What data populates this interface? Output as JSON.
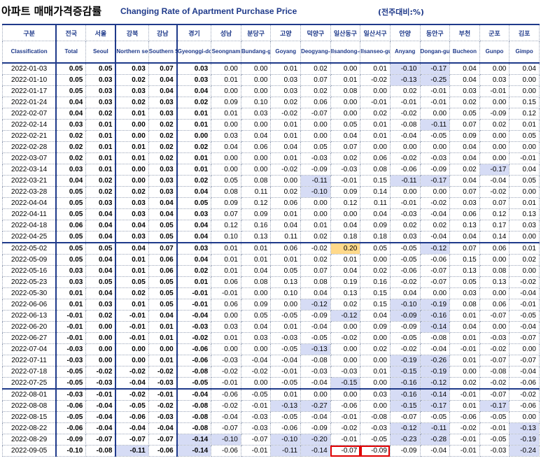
{
  "title_kr": "아파트 매매가격증감률",
  "title_en": "Changing Rate of Apartment Purchase Price",
  "title_note": "(전주대비:%)",
  "columns": [
    {
      "kr": "구분",
      "en": "Classification"
    },
    {
      "kr": "전국",
      "en": "Total"
    },
    {
      "kr": "서울",
      "en": "Seoul"
    },
    {
      "kr": "강북",
      "en": "Northern seoul"
    },
    {
      "kr": "강남",
      "en": "Southern Seoul"
    },
    {
      "kr": "경기",
      "en": "Gyeonggi-do"
    },
    {
      "kr": "성남",
      "en": "Seongnam"
    },
    {
      "kr": "분당구",
      "en": "Bundang-gu"
    },
    {
      "kr": "고양",
      "en": "Goyang"
    },
    {
      "kr": "덕양구",
      "en": "Deogyang-gu"
    },
    {
      "kr": "일산동구",
      "en": "Ilsandong-gu"
    },
    {
      "kr": "일산서구",
      "en": "Ilsanseo-gu"
    },
    {
      "kr": "안양",
      "en": "Anyang"
    },
    {
      "kr": "동안구",
      "en": "Dongan-gu"
    },
    {
      "kr": "부천",
      "en": "Bucheon"
    },
    {
      "kr": "군포",
      "en": "Gunpo"
    },
    {
      "kr": "김포",
      "en": "Gimpo"
    }
  ],
  "rows": [
    [
      "2022-01-03",
      "0.05",
      "0.05",
      "0.03",
      "0.07",
      "0.03",
      "0.00",
      "0.00",
      "0.01",
      "0.02",
      "0.00",
      "0.01",
      "-0.10",
      "-0.17",
      "0.04",
      "0.00",
      "0.04"
    ],
    [
      "2022-01-10",
      "0.05",
      "0.03",
      "0.02",
      "0.04",
      "0.03",
      "0.01",
      "0.00",
      "0.03",
      "0.07",
      "0.01",
      "-0.02",
      "-0.13",
      "-0.25",
      "0.04",
      "0.03",
      "0.00"
    ],
    [
      "2022-01-17",
      "0.05",
      "0.03",
      "0.03",
      "0.04",
      "0.04",
      "0.00",
      "0.00",
      "0.03",
      "0.02",
      "0.08",
      "0.00",
      "0.02",
      "-0.01",
      "0.03",
      "-0.01",
      "0.00"
    ],
    [
      "2022-01-24",
      "0.04",
      "0.03",
      "0.02",
      "0.03",
      "0.02",
      "0.09",
      "0.10",
      "0.02",
      "0.06",
      "0.00",
      "-0.01",
      "-0.01",
      "-0.01",
      "0.02",
      "0.00",
      "0.15"
    ],
    [
      "2022-02-07",
      "0.04",
      "0.02",
      "0.01",
      "0.03",
      "0.01",
      "0.01",
      "0.03",
      "-0.02",
      "-0.07",
      "0.00",
      "0.02",
      "-0.02",
      "0.00",
      "0.05",
      "-0.09",
      "0.12"
    ],
    [
      "2022-02-14",
      "0.03",
      "0.01",
      "0.00",
      "0.02",
      "0.01",
      "0.00",
      "0.00",
      "0.01",
      "0.00",
      "0.05",
      "0.01",
      "-0.08",
      "-0.11",
      "0.07",
      "0.02",
      "0.01"
    ],
    [
      "2022-02-21",
      "0.02",
      "0.01",
      "0.00",
      "0.02",
      "0.00",
      "0.03",
      "0.04",
      "0.01",
      "0.00",
      "0.04",
      "0.01",
      "-0.04",
      "-0.05",
      "0.09",
      "0.00",
      "0.05"
    ],
    [
      "2022-02-28",
      "0.02",
      "0.01",
      "0.01",
      "0.02",
      "0.02",
      "0.04",
      "0.06",
      "0.04",
      "0.05",
      "0.07",
      "0.00",
      "0.00",
      "0.00",
      "0.04",
      "0.00",
      "0.00"
    ],
    [
      "2022-03-07",
      "0.02",
      "0.01",
      "0.01",
      "0.02",
      "0.01",
      "0.00",
      "0.00",
      "0.01",
      "-0.03",
      "0.02",
      "0.06",
      "-0.02",
      "-0.03",
      "0.04",
      "0.00",
      "-0.01"
    ],
    [
      "2022-03-14",
      "0.03",
      "0.01",
      "0.00",
      "0.03",
      "0.01",
      "0.00",
      "0.00",
      "-0.02",
      "-0.09",
      "-0.03",
      "0.08",
      "-0.06",
      "-0.09",
      "0.02",
      "-0.17",
      "0.04"
    ],
    [
      "2022-03-21",
      "0.04",
      "0.02",
      "0.00",
      "0.03",
      "0.02",
      "0.05",
      "0.08",
      "0.00",
      "-0.11",
      "-0.01",
      "0.15",
      "-0.11",
      "-0.17",
      "0.04",
      "-0.04",
      "0.05"
    ],
    [
      "2022-03-28",
      "0.05",
      "0.02",
      "0.02",
      "0.03",
      "0.04",
      "0.08",
      "0.11",
      "0.02",
      "-0.10",
      "0.09",
      "0.14",
      "0.00",
      "0.00",
      "0.07",
      "-0.02",
      "0.00"
    ],
    [
      "2022-04-04",
      "0.05",
      "0.03",
      "0.03",
      "0.04",
      "0.05",
      "0.09",
      "0.12",
      "0.06",
      "0.00",
      "0.12",
      "0.11",
      "-0.01",
      "-0.02",
      "0.03",
      "0.07",
      "0.01"
    ],
    [
      "2022-04-11",
      "0.05",
      "0.04",
      "0.03",
      "0.04",
      "0.03",
      "0.07",
      "0.09",
      "0.01",
      "0.00",
      "0.00",
      "0.04",
      "-0.03",
      "-0.04",
      "0.06",
      "0.12",
      "0.13"
    ],
    [
      "2022-04-18",
      "0.06",
      "0.04",
      "0.04",
      "0.05",
      "0.04",
      "0.12",
      "0.16",
      "0.04",
      "0.01",
      "0.04",
      "0.09",
      "0.02",
      "0.02",
      "0.13",
      "0.17",
      "0.03"
    ],
    [
      "2022-04-25",
      "0.05",
      "0.04",
      "0.03",
      "0.05",
      "0.04",
      "0.10",
      "0.13",
      "0.11",
      "0.02",
      "0.18",
      "0.18",
      "0.03",
      "-0.04",
      "0.04",
      "0.14",
      "0.00"
    ],
    [
      "2022-05-02",
      "0.05",
      "0.05",
      "0.04",
      "0.07",
      "0.03",
      "0.01",
      "0.01",
      "0.06",
      "-0.02",
      "0.20",
      "0.05",
      "-0.05",
      "-0.12",
      "0.07",
      "0.06",
      "0.01"
    ],
    [
      "2022-05-09",
      "0.05",
      "0.04",
      "0.01",
      "0.06",
      "0.04",
      "0.01",
      "0.01",
      "0.01",
      "0.02",
      "0.01",
      "0.00",
      "-0.05",
      "-0.06",
      "0.15",
      "0.00",
      "0.02"
    ],
    [
      "2022-05-16",
      "0.03",
      "0.04",
      "0.01",
      "0.06",
      "0.02",
      "0.01",
      "0.04",
      "0.05",
      "0.07",
      "0.04",
      "0.02",
      "-0.06",
      "-0.07",
      "0.13",
      "0.08",
      "0.00"
    ],
    [
      "2022-05-23",
      "0.03",
      "0.05",
      "0.05",
      "0.05",
      "0.01",
      "0.06",
      "0.08",
      "0.13",
      "0.08",
      "0.19",
      "0.16",
      "-0.02",
      "-0.07",
      "0.05",
      "0.13",
      "-0.02"
    ],
    [
      "2022-05-30",
      "0.01",
      "0.04",
      "0.02",
      "0.05",
      "-0.01",
      "-0.01",
      "0.00",
      "0.10",
      "0.04",
      "0.13",
      "0.15",
      "0.04",
      "0.00",
      "0.03",
      "0.00",
      "-0.04"
    ],
    [
      "2022-06-06",
      "0.01",
      "0.03",
      "0.01",
      "0.05",
      "-0.01",
      "0.06",
      "0.09",
      "0.00",
      "-0.12",
      "0.02",
      "0.15",
      "-0.10",
      "-0.19",
      "0.08",
      "0.06",
      "-0.01"
    ],
    [
      "2022-06-13",
      "-0.01",
      "0.02",
      "-0.01",
      "0.04",
      "-0.04",
      "0.00",
      "0.05",
      "-0.05",
      "-0.09",
      "-0.12",
      "0.04",
      "-0.09",
      "-0.16",
      "0.01",
      "-0.07",
      "-0.05"
    ],
    [
      "2022-06-20",
      "-0.01",
      "0.00",
      "-0.01",
      "0.01",
      "-0.03",
      "0.03",
      "0.04",
      "0.01",
      "-0.04",
      "0.00",
      "0.09",
      "-0.09",
      "-0.14",
      "0.04",
      "0.00",
      "-0.04"
    ],
    [
      "2022-06-27",
      "-0.01",
      "0.00",
      "-0.01",
      "0.01",
      "-0.02",
      "0.01",
      "0.03",
      "-0.03",
      "-0.05",
      "-0.02",
      "0.00",
      "-0.05",
      "-0.08",
      "0.01",
      "-0.03",
      "-0.07"
    ],
    [
      "2022-07-04",
      "-0.03",
      "0.00",
      "0.00",
      "0.00",
      "-0.06",
      "0.00",
      "0.00",
      "-0.05",
      "-0.13",
      "0.00",
      "0.02",
      "-0.02",
      "-0.04",
      "-0.01",
      "-0.02",
      "0.00"
    ],
    [
      "2022-07-11",
      "-0.03",
      "0.00",
      "0.00",
      "0.01",
      "-0.06",
      "-0.03",
      "-0.04",
      "-0.04",
      "-0.08",
      "0.00",
      "0.00",
      "-0.19",
      "-0.26",
      "0.01",
      "-0.07",
      "-0.07"
    ],
    [
      "2022-07-18",
      "-0.05",
      "-0.02",
      "-0.02",
      "-0.02",
      "-0.08",
      "-0.02",
      "-0.02",
      "-0.01",
      "-0.03",
      "-0.03",
      "0.01",
      "-0.15",
      "-0.19",
      "0.00",
      "-0.08",
      "-0.04"
    ],
    [
      "2022-07-25",
      "-0.05",
      "-0.03",
      "-0.04",
      "-0.03",
      "-0.05",
      "-0.01",
      "0.00",
      "-0.05",
      "-0.04",
      "-0.15",
      "0.00",
      "-0.16",
      "-0.12",
      "0.02",
      "-0.02",
      "-0.06"
    ],
    [
      "2022-08-01",
      "-0.03",
      "-0.01",
      "-0.02",
      "-0.01",
      "-0.04",
      "-0.06",
      "-0.05",
      "0.01",
      "0.00",
      "0.00",
      "0.03",
      "-0.16",
      "-0.14",
      "-0.01",
      "-0.07",
      "-0.02"
    ],
    [
      "2022-08-08",
      "-0.06",
      "-0.04",
      "-0.05",
      "-0.02",
      "-0.08",
      "-0.02",
      "-0.01",
      "-0.13",
      "-0.27",
      "-0.06",
      "0.00",
      "-0.15",
      "-0.17",
      "0.01",
      "-0.17",
      "-0.06"
    ],
    [
      "2022-08-15",
      "-0.05",
      "-0.04",
      "-0.06",
      "-0.03",
      "-0.08",
      "-0.04",
      "-0.03",
      "-0.05",
      "-0.04",
      "-0.01",
      "-0.08",
      "-0.07",
      "-0.05",
      "-0.06",
      "-0.05",
      "0.00"
    ],
    [
      "2022-08-22",
      "-0.06",
      "-0.04",
      "-0.04",
      "-0.04",
      "-0.08",
      "-0.07",
      "-0.03",
      "-0.06",
      "-0.09",
      "-0.02",
      "-0.03",
      "-0.12",
      "-0.11",
      "-0.02",
      "-0.01",
      "-0.13"
    ],
    [
      "2022-08-29",
      "-0.09",
      "-0.07",
      "-0.07",
      "-0.07",
      "-0.14",
      "-0.10",
      "-0.07",
      "-0.10",
      "-0.20",
      "-0.01",
      "-0.05",
      "-0.23",
      "-0.28",
      "-0.01",
      "-0.05",
      "-0.19"
    ],
    [
      "2022-09-05",
      "-0.10",
      "-0.08",
      "-0.11",
      "-0.06",
      "-0.14",
      "-0.06",
      "-0.01",
      "-0.11",
      "-0.14",
      "-0.07",
      "-0.09",
      "-0.09",
      "-0.04",
      "-0.01",
      "-0.03",
      "-0.24"
    ]
  ],
  "highlight_blue": [
    [
      0,
      12
    ],
    [
      0,
      13
    ],
    [
      1,
      12
    ],
    [
      1,
      13
    ],
    [
      5,
      13
    ],
    [
      9,
      15
    ],
    [
      10,
      9
    ],
    [
      10,
      12
    ],
    [
      10,
      13
    ],
    [
      11,
      9
    ],
    [
      16,
      13
    ],
    [
      21,
      9
    ],
    [
      21,
      12
    ],
    [
      21,
      13
    ],
    [
      22,
      10
    ],
    [
      22,
      12
    ],
    [
      22,
      13
    ],
    [
      23,
      13
    ],
    [
      25,
      9
    ],
    [
      26,
      12
    ],
    [
      26,
      13
    ],
    [
      27,
      12
    ],
    [
      27,
      13
    ],
    [
      28,
      10
    ],
    [
      28,
      12
    ],
    [
      28,
      13
    ],
    [
      29,
      12
    ],
    [
      29,
      13
    ],
    [
      30,
      8
    ],
    [
      30,
      9
    ],
    [
      30,
      12
    ],
    [
      30,
      13
    ],
    [
      30,
      15
    ],
    [
      32,
      12
    ],
    [
      32,
      13
    ],
    [
      32,
      16
    ],
    [
      33,
      5
    ],
    [
      33,
      6
    ],
    [
      33,
      8
    ],
    [
      33,
      9
    ],
    [
      33,
      12
    ],
    [
      33,
      13
    ],
    [
      33,
      16
    ],
    [
      34,
      3
    ],
    [
      34,
      5
    ],
    [
      34,
      8
    ],
    [
      34,
      9
    ],
    [
      34,
      16
    ]
  ],
  "highlight_orange": [
    [
      16,
      10
    ]
  ],
  "highlight_redbox": [
    [
      34,
      10
    ],
    [
      34,
      11
    ]
  ],
  "bold_cols": [
    1,
    2,
    3,
    4,
    5
  ],
  "separator_rows": [
    16,
    29
  ]
}
